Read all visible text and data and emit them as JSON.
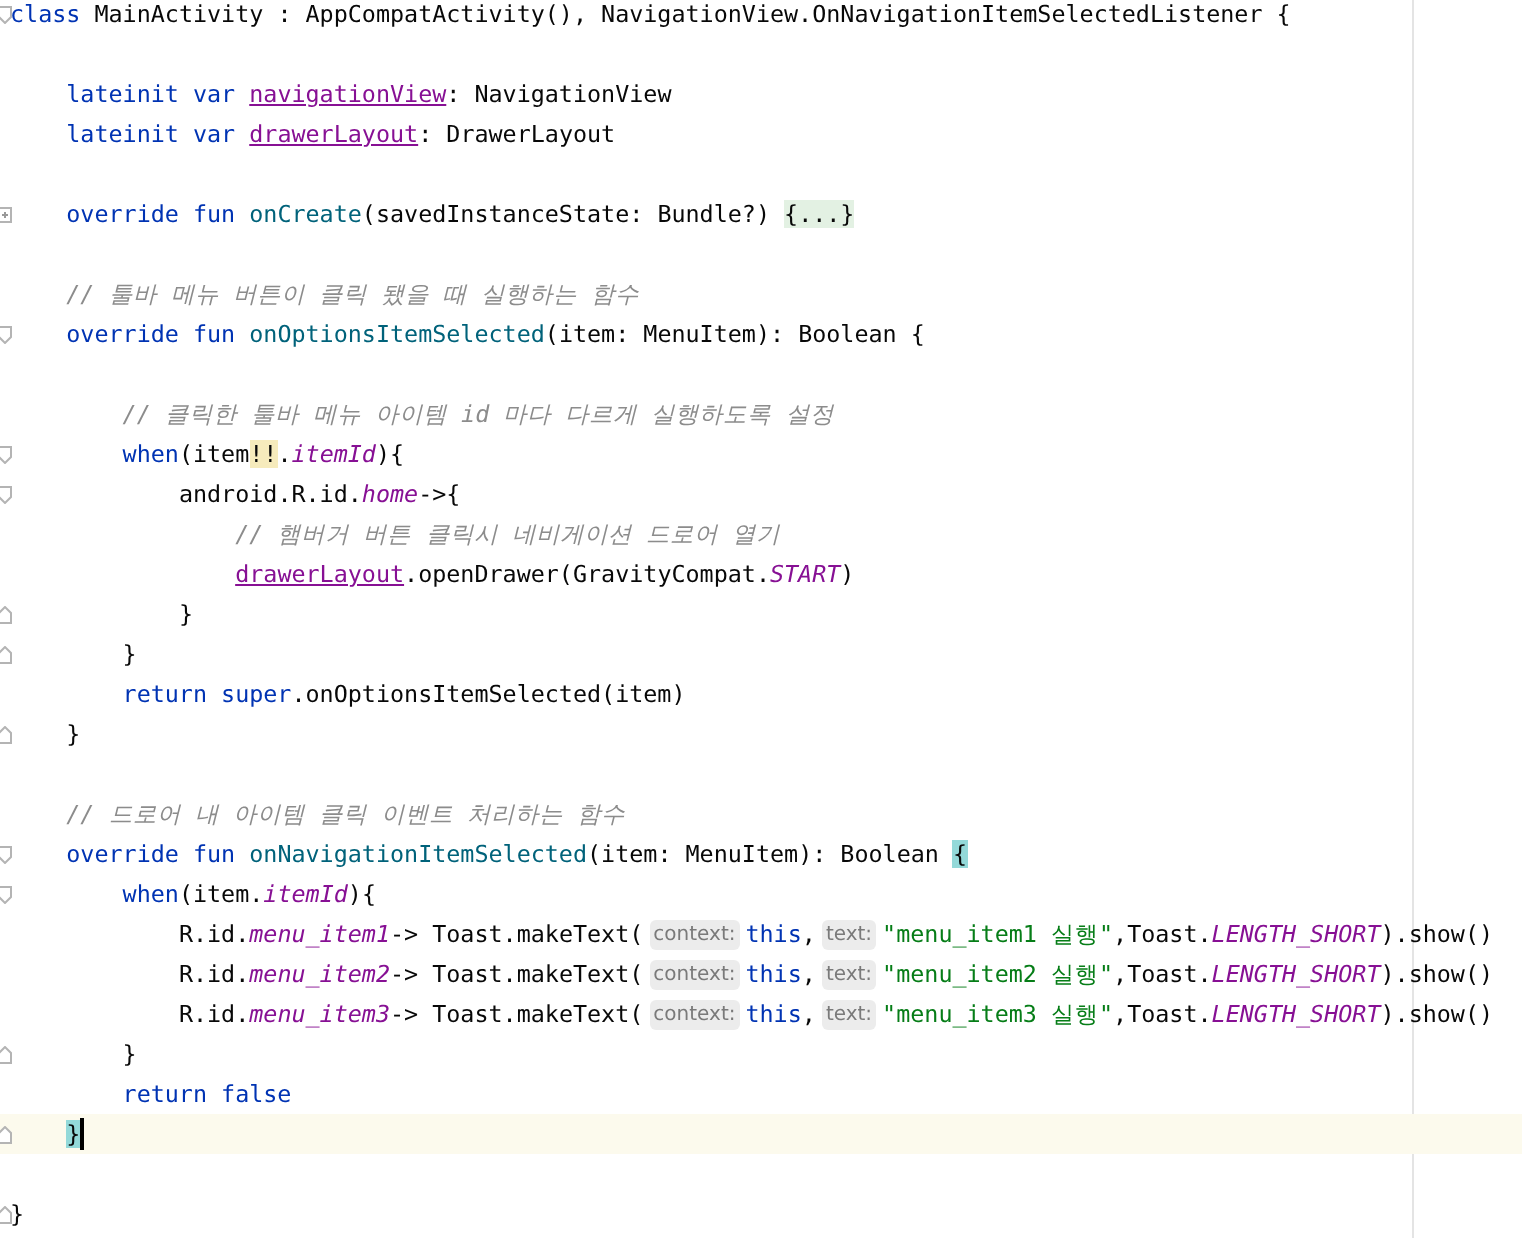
{
  "editor": {
    "lines": [
      {
        "fold_start": true,
        "fold_end": false,
        "current": false,
        "tokens": [
          {
            "kind": "kw",
            "text": "class"
          },
          {
            "kind": "plain",
            "text": " MainActivity : AppCompatActivity(), NavigationView.OnNavigationItemSelectedListener {"
          }
        ],
        "children": [
          {
            "fold_start": false,
            "fold_end": false,
            "current": false
          },
          {
            "fold_start": false,
            "fold_end": false,
            "current": false,
            "tokens": [
              {
                "kind": "kw",
                "text": "lateinit var "
              },
              {
                "kind": "field",
                "text": "navigationView"
              },
              {
                "kind": "plain",
                "text": ": NavigationView"
              }
            ]
          },
          {
            "fold_start": false,
            "fold_end": false,
            "current": false,
            "tokens": [
              {
                "kind": "kw",
                "text": "lateinit var "
              },
              {
                "kind": "field",
                "text": "drawerLayout"
              },
              {
                "kind": "plain",
                "text": ": DrawerLayout"
              }
            ]
          },
          {
            "fold_start": false,
            "fold_end": false,
            "current": false
          },
          {
            "fold_start": true,
            "fold_end": false,
            "current": false,
            "tokens": [
              {
                "kind": "kw",
                "text": "override fun "
              },
              {
                "kind": "decl",
                "text": "onCreate"
              },
              {
                "kind": "plain",
                "text": "(savedInstanceState: Bundle?) "
              },
              {
                "kind": "folded",
                "text": "{...}"
              }
            ]
          },
          {
            "fold_start": false,
            "fold_end": false,
            "current": false
          },
          {
            "fold_start": false,
            "fold_end": false,
            "current": false,
            "tokens": [
              {
                "kind": "comment",
                "text": "// 툴바 메뉴 버튼이 클릭 됐을 때 실행하는 함수"
              }
            ]
          },
          {
            "fold_start": true,
            "fold_end": false,
            "current": false,
            "tokens": [
              {
                "kind": "kw",
                "text": "override fun "
              },
              {
                "kind": "decl",
                "text": "onOptionsItemSelected"
              },
              {
                "kind": "plain",
                "text": "(item: MenuItem): Boolean {"
              }
            ],
            "children": [
              {
                "fold_start": false,
                "fold_end": false,
                "current": false
              },
              {
                "fold_start": false,
                "fold_end": false,
                "current": false,
                "tokens": [
                  {
                    "kind": "comment",
                    "text": "// 클릭한 툴바 메뉴 아이템 id 마다 다르게 실행하도록 설정"
                  }
                ]
              },
              {
                "fold_start": true,
                "fold_end": false,
                "current": false,
                "tokens": [
                  {
                    "kind": "kw",
                    "text": "when"
                  },
                  {
                    "kind": "plain",
                    "text": "(item"
                  },
                  {
                    "kind": "warn",
                    "text": "!!"
                  },
                  {
                    "kind": "plain",
                    "text": "."
                  },
                  {
                    "kind": "const",
                    "text": "itemId"
                  },
                  {
                    "kind": "plain",
                    "text": "){"
                  }
                ],
                "children": [
                  {
                    "fold_start": true,
                    "fold_end": false,
                    "current": false,
                    "tokens": [
                      {
                        "kind": "plain",
                        "text": "android.R.id."
                      },
                      {
                        "kind": "const",
                        "text": "home"
                      },
                      {
                        "kind": "plain",
                        "text": "->{"
                      }
                    ],
                    "children": [
                      {
                        "fold_start": false,
                        "fold_end": false,
                        "current": false,
                        "tokens": [
                          {
                            "kind": "comment",
                            "text": "// 햄버거 버튼 클릭시 네비게이션 드로어 열기"
                          }
                        ]
                      },
                      {
                        "fold_start": false,
                        "fold_end": false,
                        "current": false,
                        "tokens": [
                          {
                            "kind": "field",
                            "text": "drawerLayout"
                          },
                          {
                            "kind": "plain",
                            "text": ".openDrawer(GravityCompat."
                          },
                          {
                            "kind": "const",
                            "text": "START"
                          },
                          {
                            "kind": "plain",
                            "text": ")"
                          }
                        ]
                      }
                    ]
                  },
                  {
                    "fold_start": false,
                    "fold_end": true,
                    "current": false,
                    "tokens": [
                      {
                        "kind": "plain",
                        "text": "}"
                      }
                    ]
                  }
                ]
              },
              {
                "fold_start": false,
                "fold_end": true,
                "current": false,
                "tokens": [
                  {
                    "kind": "plain",
                    "text": "}"
                  }
                ]
              },
              {
                "fold_start": false,
                "fold_end": false,
                "current": false,
                "tokens": [
                  {
                    "kind": "kw",
                    "text": "return super"
                  },
                  {
                    "kind": "plain",
                    "text": ".onOptionsItemSelected(item)"
                  }
                ]
              }
            ]
          },
          {
            "fold_start": false,
            "fold_end": true,
            "current": false,
            "tokens": [
              {
                "kind": "plain",
                "text": "}"
              }
            ]
          },
          {
            "fold_start": false,
            "fold_end": false,
            "current": false
          },
          {
            "fold_start": false,
            "fold_end": false,
            "current": false,
            "tokens": [
              {
                "kind": "comment",
                "text": "// 드로어 내 아이템 클릭 이벤트 처리하는 함수"
              }
            ]
          },
          {
            "fold_start": true,
            "fold_end": false,
            "current": false,
            "tokens": [
              {
                "kind": "kw",
                "text": "override fun "
              },
              {
                "kind": "decl",
                "text": "onNavigationItemSelected"
              },
              {
                "kind": "plain",
                "text": "(item: MenuItem): Boolean "
              },
              {
                "kind": "match",
                "text": "{"
              }
            ],
            "children": [
              {
                "fold_start": true,
                "fold_end": false,
                "current": false,
                "tokens": [
                  {
                    "kind": "kw",
                    "text": "when"
                  },
                  {
                    "kind": "plain",
                    "text": "(item."
                  },
                  {
                    "kind": "const",
                    "text": "itemId"
                  },
                  {
                    "kind": "plain",
                    "text": "){"
                  }
                ],
                "children": [
                  {
                    "fold_start": false,
                    "fold_end": false,
                    "current": false,
                    "tokens": [
                      {
                        "kind": "plain",
                        "text": "R.id."
                      },
                      {
                        "kind": "const",
                        "text": "menu_item1"
                      },
                      {
                        "kind": "plain",
                        "text": "-> Toast.makeText("
                      },
                      {
                        "kind": "hint",
                        "text": "context:"
                      },
                      {
                        "kind": "kw",
                        "text": "this"
                      },
                      {
                        "kind": "plain",
                        "text": ","
                      },
                      {
                        "kind": "hint",
                        "text": "text:"
                      },
                      {
                        "kind": "string",
                        "text": "\"menu_item1 실행\""
                      },
                      {
                        "kind": "plain",
                        "text": ",Toast."
                      },
                      {
                        "kind": "const",
                        "text": "LENGTH_SHORT"
                      },
                      {
                        "kind": "plain",
                        "text": ").show()"
                      }
                    ]
                  },
                  {
                    "fold_start": false,
                    "fold_end": false,
                    "current": false,
                    "tokens": [
                      {
                        "kind": "plain",
                        "text": "R.id."
                      },
                      {
                        "kind": "const",
                        "text": "menu_item2"
                      },
                      {
                        "kind": "plain",
                        "text": "-> Toast.makeText("
                      },
                      {
                        "kind": "hint",
                        "text": "context:"
                      },
                      {
                        "kind": "kw",
                        "text": "this"
                      },
                      {
                        "kind": "plain",
                        "text": ","
                      },
                      {
                        "kind": "hint",
                        "text": "text:"
                      },
                      {
                        "kind": "string",
                        "text": "\"menu_item2 실행\""
                      },
                      {
                        "kind": "plain",
                        "text": ",Toast."
                      },
                      {
                        "kind": "const",
                        "text": "LENGTH_SHORT"
                      },
                      {
                        "kind": "plain",
                        "text": ").show()"
                      }
                    ]
                  },
                  {
                    "fold_start": false,
                    "fold_end": false,
                    "current": false,
                    "tokens": [
                      {
                        "kind": "plain",
                        "text": "R.id."
                      },
                      {
                        "kind": "const",
                        "text": "menu_item3"
                      },
                      {
                        "kind": "plain",
                        "text": "-> Toast.makeText("
                      },
                      {
                        "kind": "hint",
                        "text": "context:"
                      },
                      {
                        "kind": "kw",
                        "text": "this"
                      },
                      {
                        "kind": "plain",
                        "text": ","
                      },
                      {
                        "kind": "hint",
                        "text": "text:"
                      },
                      {
                        "kind": "string",
                        "text": "\"menu_item3 실행\""
                      },
                      {
                        "kind": "plain",
                        "text": ",Toast."
                      },
                      {
                        "kind": "const",
                        "text": "LENGTH_SHORT"
                      },
                      {
                        "kind": "plain",
                        "text": ").show()"
                      }
                    ]
                  }
                ]
              },
              {
                "fold_start": false,
                "fold_end": true,
                "current": false,
                "tokens": [
                  {
                    "kind": "plain",
                    "text": "}"
                  }
                ]
              },
              {
                "fold_start": false,
                "fold_end": false,
                "current": false,
                "tokens": [
                  {
                    "kind": "kw",
                    "text": "return false"
                  }
                ]
              }
            ]
          },
          {
            "fold_start": false,
            "fold_end": true,
            "current": true,
            "tokens": [
              {
                "kind": "match",
                "text": "}"
              }
            ]
          },
          {
            "fold_start": false,
            "fold_end": false,
            "current": false
          }
        ]
      },
      {
        "fold_start": false,
        "fold_end": true,
        "current": false,
        "tokens": [
          {
            "kind": "plain",
            "text": "}"
          }
        ]
      }
    ]
  }
}
